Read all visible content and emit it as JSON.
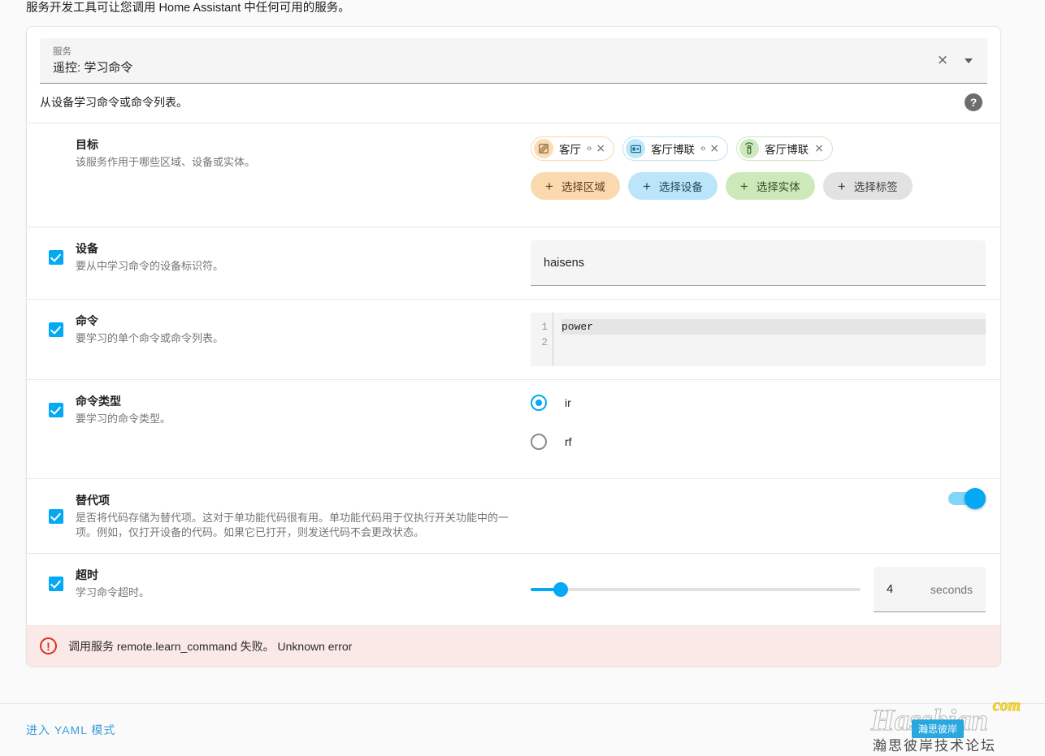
{
  "intro": "服务开发工具可让您调用 Home Assistant 中任何可用的服务。",
  "service_picker": {
    "label": "服务",
    "value": "遥控: 学习命令",
    "clear_icon": "×",
    "dropdown_icon": "chevron-down"
  },
  "service_description": "从设备学习命令或命令列表。",
  "help_icon": "?",
  "target": {
    "title": "目标",
    "subtitle": "该服务作用于哪些区域、设备或实体。",
    "chips": [
      {
        "type": "area",
        "label": "客厅",
        "expand": "‹›",
        "close": "×",
        "icon": "area-icon"
      },
      {
        "type": "device",
        "label": "客厅博联",
        "expand": "‹›",
        "close": "×",
        "icon": "device-icon"
      },
      {
        "type": "entity",
        "label": "客厅博联",
        "expand": "",
        "close": "×",
        "icon": "remote-icon"
      }
    ],
    "pills": [
      {
        "type": "area",
        "label": "选择区域"
      },
      {
        "type": "device",
        "label": "选择设备"
      },
      {
        "type": "entity",
        "label": "选择实体"
      },
      {
        "type": "label",
        "label": "选择标签"
      }
    ]
  },
  "device_field": {
    "checked": true,
    "title": "设备",
    "subtitle": "要从中学习命令的设备标识符。",
    "value": "haisens"
  },
  "command_field": {
    "checked": true,
    "title": "命令",
    "subtitle": "要学习的单个命令或命令列表。",
    "lines": [
      "power",
      ""
    ],
    "line_numbers": [
      "1",
      "2"
    ]
  },
  "command_type_field": {
    "checked": true,
    "title": "命令类型",
    "subtitle": "要学习的命令类型。",
    "options": [
      {
        "label": "ir",
        "selected": true
      },
      {
        "label": "rf",
        "selected": false
      }
    ]
  },
  "alternative_field": {
    "checked": true,
    "title": "替代项",
    "subtitle": "是否将代码存储为替代项。这对于单功能代码很有用。单功能代码用于仅执行开关功能中的一项。例如，仅打开设备的代码。如果它已打开，则发送代码不会更改状态。",
    "toggle_on": true
  },
  "timeout_field": {
    "checked": true,
    "title": "超时",
    "subtitle": "学习命令超时。",
    "slider_value": 4,
    "slider_percent": 9,
    "number_value": "4",
    "unit": "seconds"
  },
  "error": {
    "icon": "!",
    "message": "调用服务 remote.learn_command 失败。  Unknown error"
  },
  "footer": {
    "yaml_link": "进入 YAML 模式"
  },
  "watermark": {
    "main": "Hassbian",
    "tld": "com",
    "badge": "瀚思彼岸",
    "sub": "瀚思彼岸技术论坛"
  },
  "colors": {
    "accent": "#03a9f4",
    "area": "#fbd9ae",
    "device": "#bbe5f8",
    "entity": "#cde9ba",
    "label": "#e2e2e2",
    "error_bg": "#fbe9e7",
    "error_fg": "#d93025",
    "link": "#3b9ddd"
  }
}
